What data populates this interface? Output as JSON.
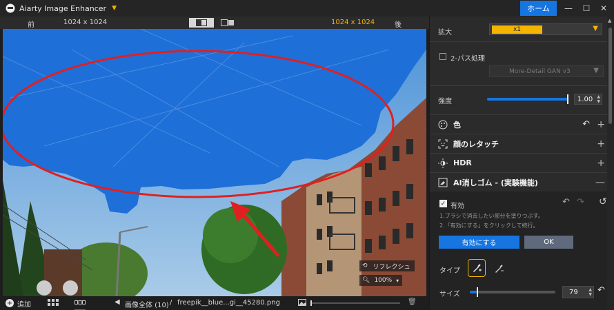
{
  "app": {
    "title": "Aiarty Image Enhancer",
    "home_label": "ホーム"
  },
  "compare_bar": {
    "before_label": "前",
    "before_size": "1024 x 1024",
    "after_size": "1024 x 1024",
    "after_label": "後"
  },
  "image_tools": {
    "reflect_label": "リフレクシュ",
    "zoom": "100%"
  },
  "bottom_bar": {
    "add_label": "追加",
    "all_images": "画像全体 (10)",
    "separator": "/",
    "filename": "freepik__blue...gi__45280.png"
  },
  "panel": {
    "scale": {
      "label": "拡大",
      "value": "x1"
    },
    "two_pass": {
      "label": "2-パス処理",
      "checked": false
    },
    "model": {
      "value": "More-Detail GAN  v3"
    },
    "strength": {
      "label": "強度",
      "value": "1.00",
      "level": 1.0
    },
    "sections": [
      {
        "title": "色",
        "icon": "palette-icon"
      },
      {
        "title": "顔のレタッチ",
        "icon": "face-icon"
      },
      {
        "title": "HDR",
        "icon": "hdr-icon"
      },
      {
        "title": "AI消しゴム - (実験機能)",
        "icon": "eraser-icon"
      }
    ],
    "eraser": {
      "enabled_label": "有効",
      "enabled": true,
      "instruction_1": "1.ブラシで消去したい部分を塗りつぶす。",
      "instruction_2": "2.「有効にする」をクリックして続行。",
      "enable_button": "有効にする",
      "ok_button": "OK",
      "type_label": "タイプ",
      "size_label": "サイズ",
      "size_value": "79",
      "size_level": 0.08
    }
  },
  "colors": {
    "accent": "#1675e0",
    "highlight": "#f5b400",
    "mask": "#1f6fd8",
    "annotation": "#e02020"
  }
}
